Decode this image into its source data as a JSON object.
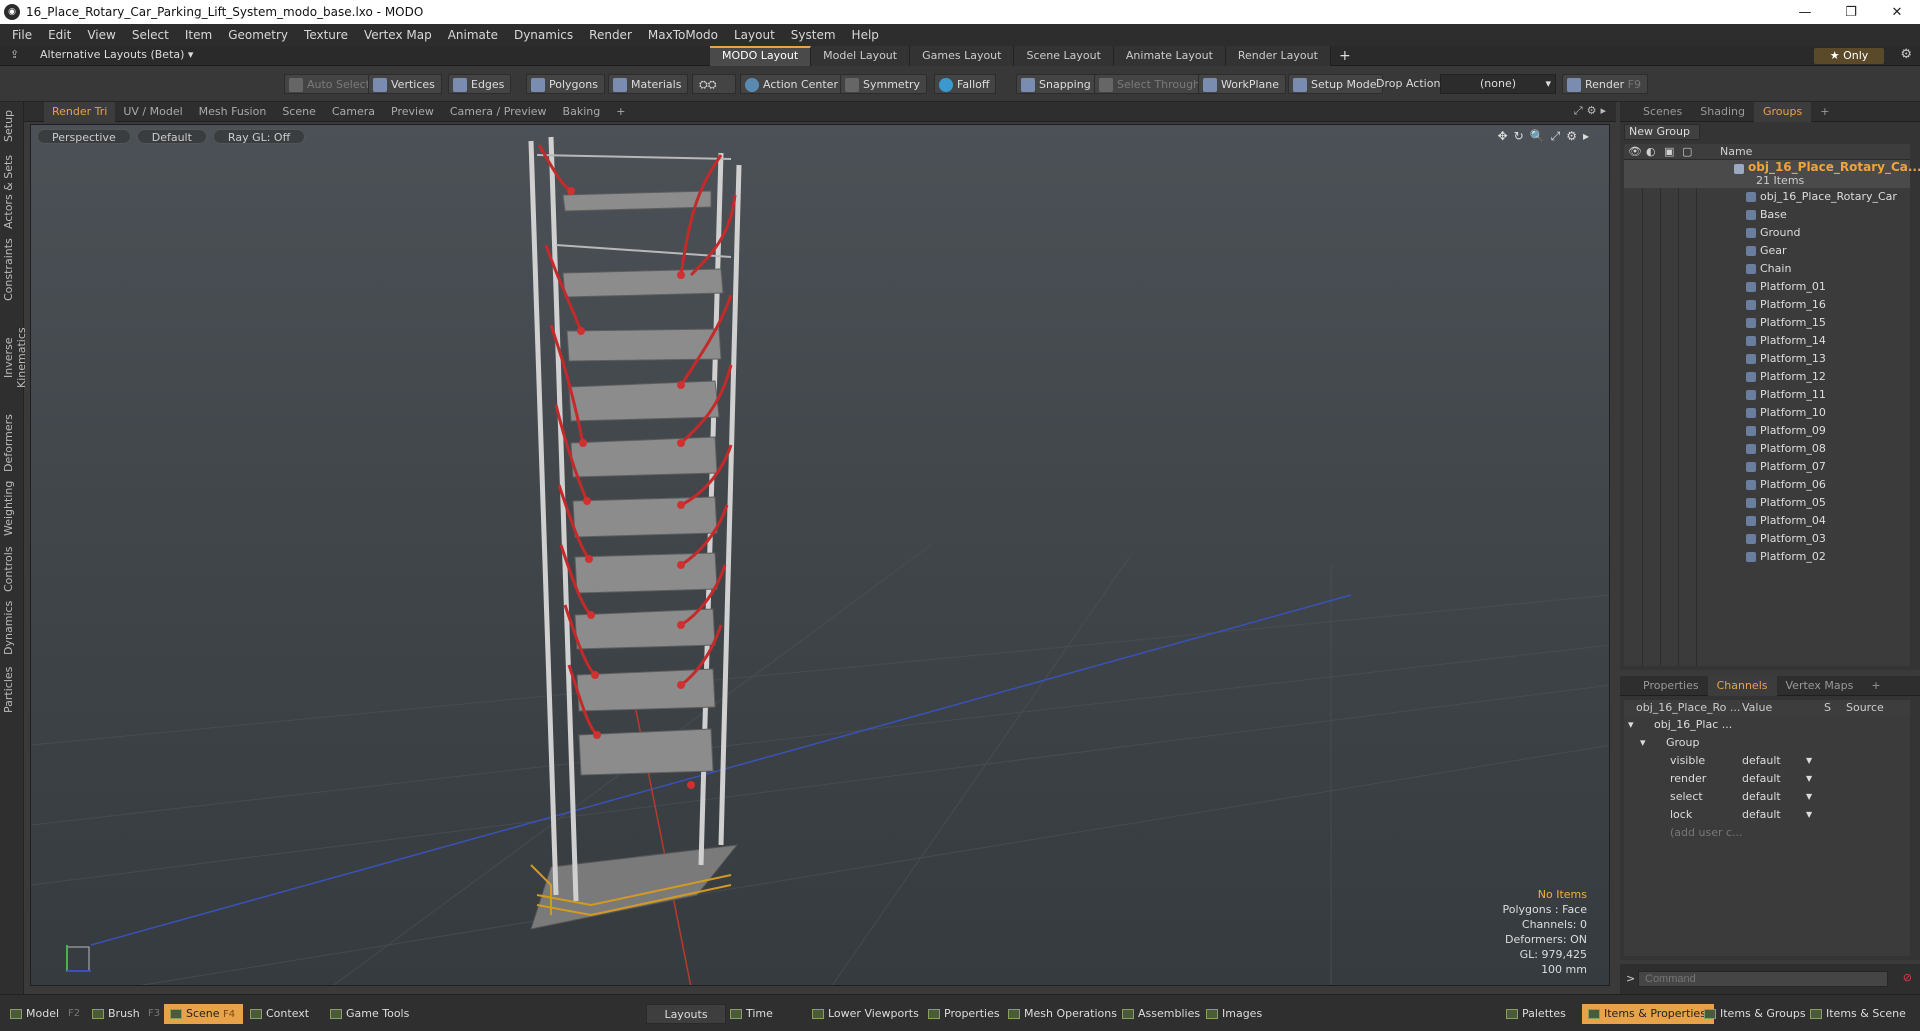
{
  "window": {
    "title": "16_Place_Rotary_Car_Parking_Lift_System_modo_base.lxo - MODO",
    "app_icon": "modo-logo-icon",
    "controls": [
      "minimize",
      "restore",
      "close"
    ]
  },
  "menu": [
    "File",
    "Edit",
    "View",
    "Select",
    "Item",
    "Geometry",
    "Texture",
    "Vertex Map",
    "Animate",
    "Dynamics",
    "Render",
    "MaxToModo",
    "Layout",
    "System",
    "Help"
  ],
  "layout_bar": {
    "alt_layouts": "Alternative Layouts (Beta)",
    "tabs": [
      "MODO Layout",
      "Model Layout",
      "Games Layout",
      "Scene Layout",
      "Animate Layout",
      "Render Layout"
    ],
    "active_tab": "MODO Layout",
    "add": "+",
    "only": "Only"
  },
  "toolbar": {
    "auto_select": "Auto Select",
    "vertices": "Vertices",
    "edges": "Edges",
    "polygons": "Polygons",
    "materials": "Materials",
    "action_center": "Action Center",
    "symmetry": "Symmetry",
    "falloff": "Falloff",
    "snapping": "Snapping",
    "select_through": "Select Through",
    "workplane": "WorkPlane",
    "setup_mode": "Setup Mode",
    "drop_action_label": "Drop Action",
    "drop_action_value": "(none)",
    "render": "Render",
    "render_key": "F9"
  },
  "left_tabs": [
    "Setup",
    "Actors & Sets",
    "Constraints",
    "Inverse Kinematics",
    "Deformers",
    "Weighting",
    "Controls",
    "Dynamics",
    "Particles"
  ],
  "viewport_tabs": {
    "tabs": [
      "Render Tri",
      "UV / Model",
      "Mesh Fusion",
      "Scene",
      "Camera",
      "Preview",
      "Camera / Preview",
      "Baking"
    ],
    "active": "Render Tri",
    "add": "+"
  },
  "viewport": {
    "view": "Perspective",
    "shading": "Default",
    "raygl": "Ray GL: Off",
    "info": {
      "items": "No Items",
      "polygons": "Polygons : Face",
      "channels": "Channels: 0",
      "deformers": "Deformers: ON",
      "gl": "GL: 979,425",
      "scale": "100 mm"
    },
    "colors": {
      "frame": "#d8d8d8",
      "arm": "#c83030",
      "platform": "#8a8a8a",
      "rail": "#d49a20"
    }
  },
  "right_tabs": {
    "tabs": [
      "Scenes",
      "Shading",
      "Groups"
    ],
    "active": "Groups",
    "add": "+"
  },
  "groups": {
    "new_group": "New Group",
    "name_col": "Name",
    "root": {
      "name": "obj_16_Place_Rotary_Ca...",
      "count": "21 Items"
    },
    "items": [
      "obj_16_Place_Rotary_Car ...",
      "Base",
      "Ground",
      "Gear",
      "Chain",
      "Platform_01",
      "Platform_16",
      "Platform_15",
      "Platform_14",
      "Platform_13",
      "Platform_12",
      "Platform_11",
      "Platform_10",
      "Platform_09",
      "Platform_08",
      "Platform_07",
      "Platform_06",
      "Platform_05",
      "Platform_04",
      "Platform_03",
      "Platform_02"
    ]
  },
  "channel_tabs": {
    "tabs": [
      "Properties",
      "Channels",
      "Vertex Maps"
    ],
    "active": "Channels",
    "add": "+"
  },
  "channels": {
    "headers": {
      "name": "obj_16_Place_Ro ...",
      "value": "Value",
      "s": "S",
      "source": "Source"
    },
    "object": "obj_16_Plac ...",
    "group": "Group",
    "rows": [
      {
        "name": "visible",
        "value": "default"
      },
      {
        "name": "render",
        "value": "default"
      },
      {
        "name": "select",
        "value": "default"
      },
      {
        "name": "lock",
        "value": "default"
      }
    ],
    "add_user": "(add user c..."
  },
  "command": {
    "prompt": ">",
    "placeholder": "Command"
  },
  "bottom": {
    "model": "Model",
    "model_key": "F2",
    "brush": "Brush",
    "brush_key": "F3",
    "scene": "Scene",
    "scene_key": "F4",
    "context": "Context",
    "game_tools": "Game Tools",
    "layouts": "Layouts",
    "time": "Time",
    "lower_viewports": "Lower Viewports",
    "properties": "Properties",
    "mesh_operations": "Mesh Operations",
    "assemblies": "Assemblies",
    "images": "Images",
    "palettes": "Palettes",
    "items_properties": "Items & Properties",
    "items_groups": "Items & Groups",
    "items_scene": "Items & Scene"
  }
}
